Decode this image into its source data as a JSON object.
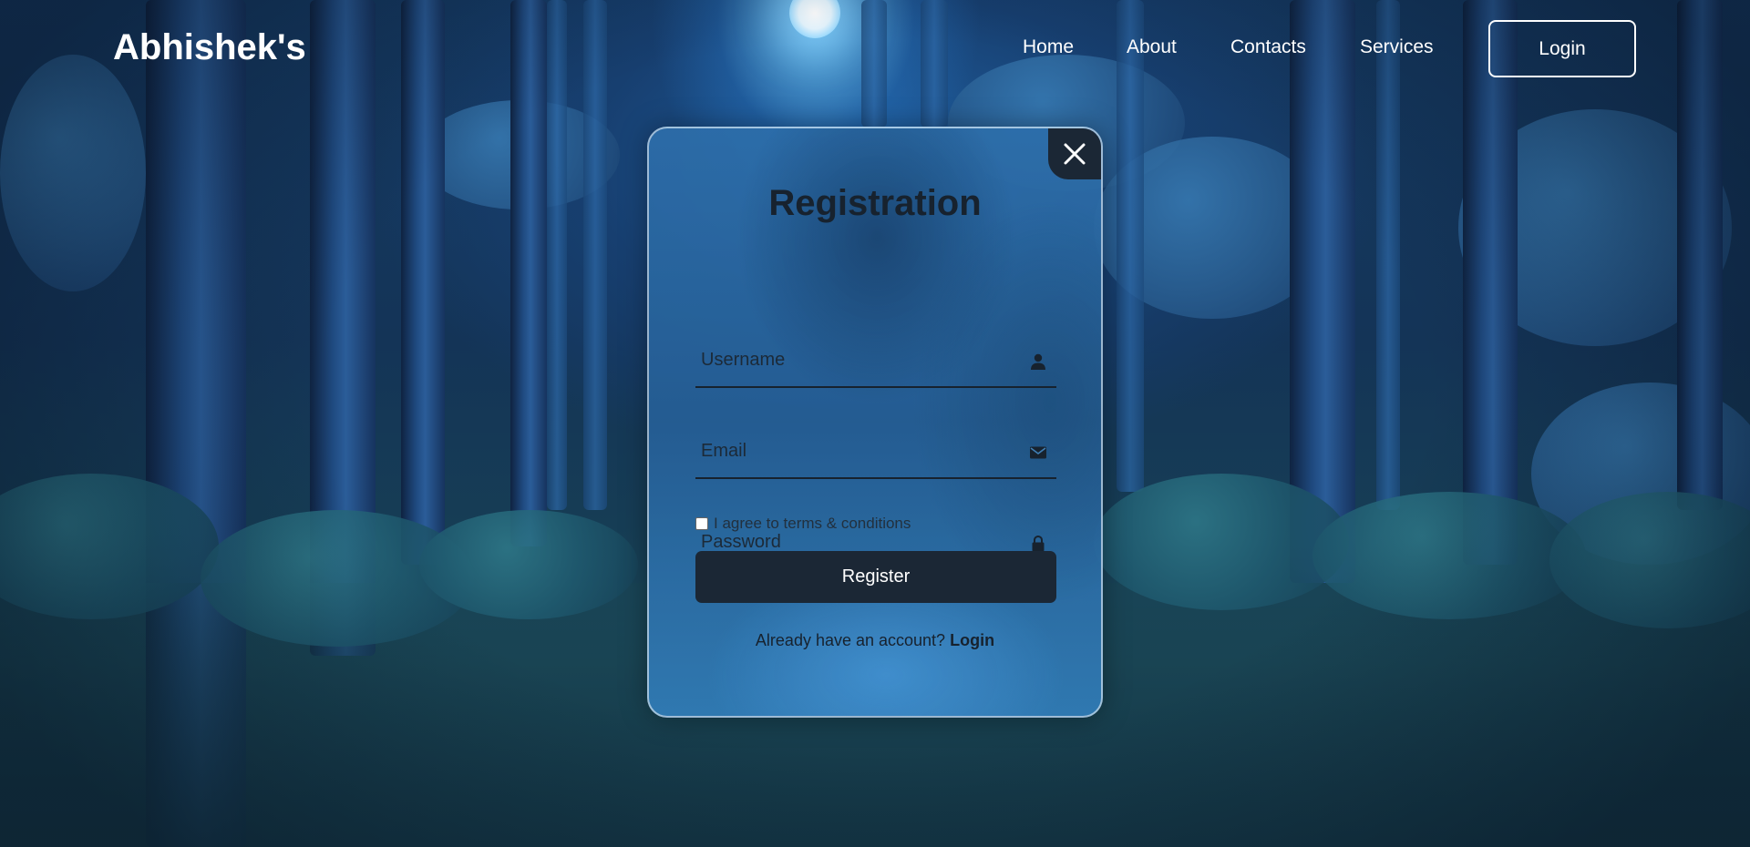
{
  "header": {
    "logo": "Abhishek's",
    "nav": [
      {
        "label": "Home"
      },
      {
        "label": "About"
      },
      {
        "label": "Contacts"
      },
      {
        "label": "Services"
      }
    ],
    "login_button": "Login"
  },
  "modal": {
    "title": "Registration",
    "close_icon": "close-icon",
    "fields": {
      "username": {
        "placeholder": "Username",
        "value": "",
        "icon": "person-icon"
      },
      "email": {
        "placeholder": "Email",
        "value": "",
        "icon": "mail-icon"
      },
      "password": {
        "placeholder": "Password",
        "value": "",
        "icon": "lock-icon"
      }
    },
    "terms": {
      "label": "I agree to terms & conditions",
      "checked": false
    },
    "register_button": "Register",
    "switch_prompt": "Already have an account?",
    "switch_link": "Login"
  },
  "colors": {
    "dark_button": "#1b2735",
    "text_dark": "#17222e",
    "header_text": "#ffffff"
  }
}
